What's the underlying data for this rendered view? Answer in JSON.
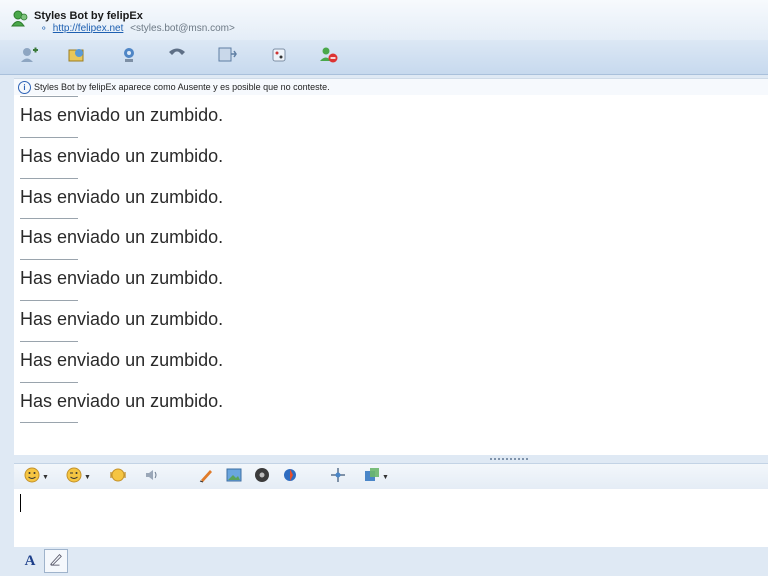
{
  "header": {
    "contact_name": "Styles Bot by felipEx",
    "contact_url": "http://felipex.net",
    "contact_email": "<styles.bot@msn.com>"
  },
  "toolbar": {
    "buttons": [
      {
        "icon": "invite-icon"
      },
      {
        "icon": "send-files-icon"
      },
      {
        "icon": "webcam-icon"
      },
      {
        "icon": "call-icon"
      },
      {
        "icon": "activities-icon"
      },
      {
        "icon": "games-icon"
      },
      {
        "icon": "block-icon"
      }
    ]
  },
  "infobar": {
    "text": "Styles Bot by felipEx aparece como Ausente y es posible que no conteste."
  },
  "conversation": {
    "messages": [
      "Has enviado un zumbido.",
      "Has enviado un zumbido.",
      "Has enviado un zumbido.",
      "Has enviado un zumbido.",
      "Has enviado un zumbido.",
      "Has enviado un zumbido.",
      "Has enviado un zumbido.",
      "Has enviado un zumbido."
    ]
  },
  "format_bar": {
    "buttons": [
      {
        "icon": "emoticon-icon"
      },
      {
        "icon": "wink-icon"
      },
      {
        "icon": "nudge-icon"
      },
      {
        "icon": "voice-clip-icon"
      },
      {
        "icon": "ink-icon"
      },
      {
        "icon": "image-icon"
      },
      {
        "icon": "music-icon"
      },
      {
        "icon": "gift-icon"
      },
      {
        "icon": "sparkle-icon"
      },
      {
        "icon": "background-icon"
      }
    ]
  },
  "input": {
    "value": "",
    "placeholder": ""
  },
  "colors": {
    "window_bg": "#dfe9f4",
    "link": "#1d5fb1",
    "message_text": "#2a2a2a"
  }
}
